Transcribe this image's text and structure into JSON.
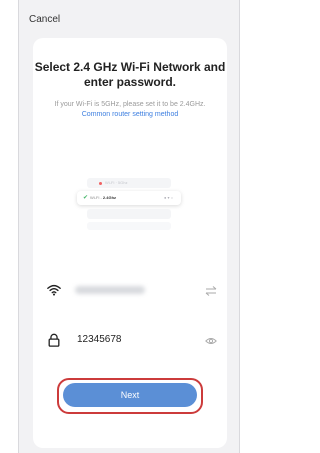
{
  "header": {
    "cancel_label": "Cancel"
  },
  "main": {
    "title": "Select 2.4 GHz Wi-Fi Network and enter password.",
    "subtitle_text": "If your Wi-Fi is 5GHz, please set it to be 2.4GHz.",
    "subtitle_link": "Common router setting method"
  },
  "illustration": {
    "top_label": "Wi-Fi · 5Ghz",
    "selected_prefix": "Wi-Fi -",
    "selected_band": "2.4Ghz"
  },
  "wifi": {
    "icon": "wifi-icon",
    "switch_icon": "swap-icon"
  },
  "password": {
    "value": "12345678",
    "icon": "lock-icon",
    "toggle_icon": "eye-icon"
  },
  "next_button": {
    "label": "Next",
    "highlight_color": "#cc3b3b",
    "color": "#5b8fd6"
  }
}
